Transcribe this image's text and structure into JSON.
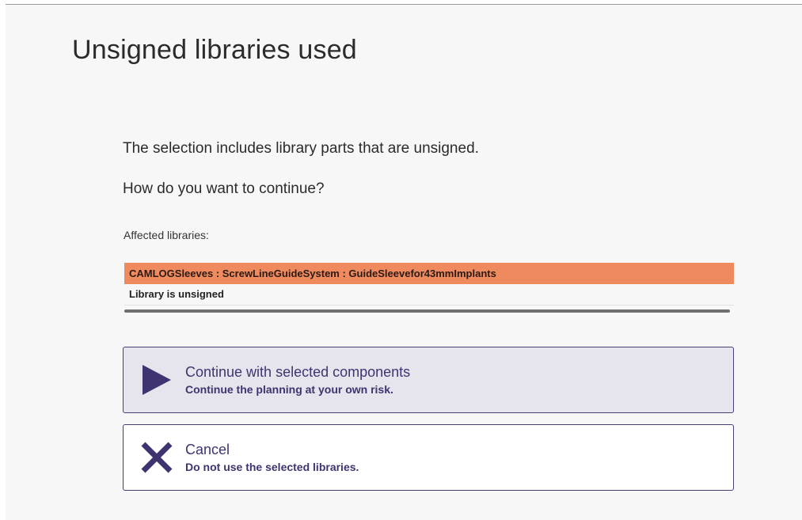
{
  "dialog": {
    "title": "Unsigned libraries used",
    "message_line1": "The selection includes library parts that are unsigned.",
    "message_line2": "How do you want to continue?",
    "affected_label": "Affected libraries:"
  },
  "libraries": [
    {
      "name": "CAMLOGSleeves : ScrewLineGuideSystem : GuideSleevefor43mmImplants",
      "status": "Library is unsigned",
      "highlight_color": "#ef8a5f"
    }
  ],
  "options": {
    "continue": {
      "title": "Continue with selected components",
      "subtitle": "Continue the planning at your own risk.",
      "icon": "play-icon"
    },
    "cancel": {
      "title": "Cancel",
      "subtitle": "Do not use the selected libraries.",
      "icon": "close-icon"
    }
  },
  "colors": {
    "accent": "#3f3470",
    "warning": "#ef8a5f",
    "selected_option_bg": "#e6e4ec"
  }
}
